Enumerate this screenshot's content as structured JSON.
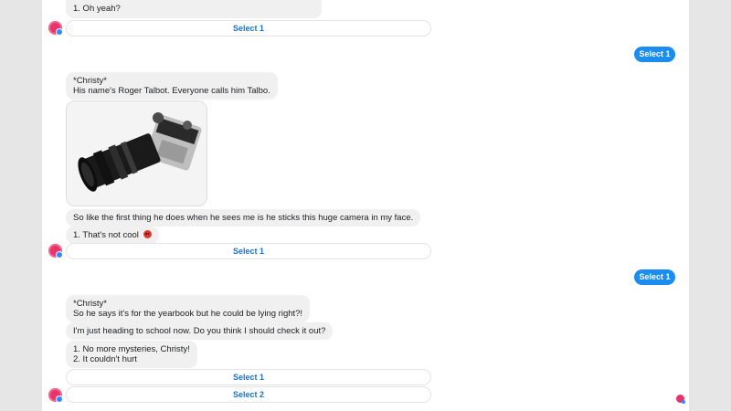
{
  "chat": {
    "m1": {
      "line": "1. Oh yeah?"
    },
    "select_a": {
      "label": "Select 1"
    },
    "user_a": {
      "label": "Select 1"
    },
    "m2": {
      "speaker": "*Christy*",
      "text": "His name's Roger Talbot. Everyone calls him Talbo."
    },
    "m3": {
      "text": "So like the first thing he does when he sees me is he sticks this huge camera in my face."
    },
    "m4": {
      "text": "1. That's not cool"
    },
    "select_b": {
      "label": "Select 1"
    },
    "user_b": {
      "label": "Select 1"
    },
    "m5": {
      "speaker": "*Christy*",
      "text": "So he says it's for the yearbook but he could be lying right?!"
    },
    "m6": {
      "text": "I'm just heading to school now. Do you think I should check it out?"
    },
    "m7": {
      "line1": "1. No more mysteries, Christy!",
      "line2": "2. It couldn't hurt"
    },
    "select_c1": {
      "label": "Select 1"
    },
    "select_c2": {
      "label": "Select 2"
    }
  },
  "icons": {
    "avatar": "bot-avatar-icon",
    "photo": "camera-photo",
    "emoji": "angry-face-emoji",
    "corner": "chat-head-icon"
  },
  "colors": {
    "page_bg": "#e6e6e6",
    "panel_bg": "#ffffff",
    "bubble_bg": "#f0f0f0",
    "user_bubble": "#1b8cf0",
    "button_text": "#1a73c8",
    "avatar": "#e8336b"
  }
}
